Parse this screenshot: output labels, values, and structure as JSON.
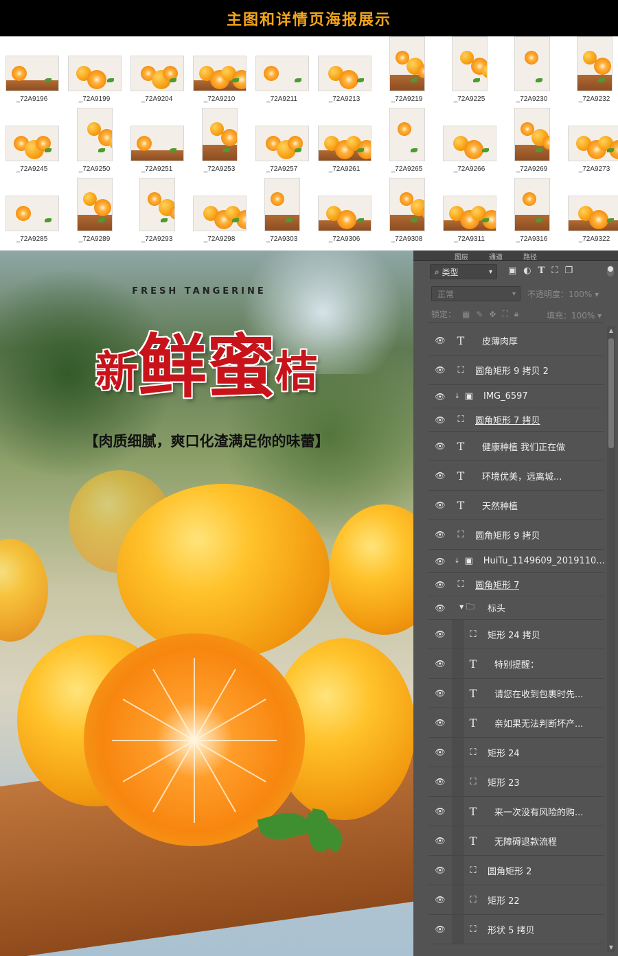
{
  "header": {
    "title": "主图和详情页海报展示"
  },
  "thumbnails": [
    {
      "label": "_72A9196"
    },
    {
      "label": "_72A9199"
    },
    {
      "label": "_72A9204"
    },
    {
      "label": "_72A9210"
    },
    {
      "label": "_72A9211"
    },
    {
      "label": "_72A9213"
    },
    {
      "label": "_72A9219"
    },
    {
      "label": "_72A9225"
    },
    {
      "label": "_72A9230"
    },
    {
      "label": "_72A9232"
    },
    {
      "label": "_72A9245"
    },
    {
      "label": "_72A9250"
    },
    {
      "label": "_72A9251"
    },
    {
      "label": "_72A9253"
    },
    {
      "label": "_72A9257"
    },
    {
      "label": "_72A9261"
    },
    {
      "label": "_72A9265"
    },
    {
      "label": "_72A9266"
    },
    {
      "label": "_72A9269"
    },
    {
      "label": "_72A9273"
    },
    {
      "label": "_72A9285"
    },
    {
      "label": "_72A9289"
    },
    {
      "label": "_72A9293"
    },
    {
      "label": "_72A9298"
    },
    {
      "label": "_72A9303"
    },
    {
      "label": "_72A9306"
    },
    {
      "label": "_72A9308"
    },
    {
      "label": "_72A9311"
    },
    {
      "label": "_72A9316"
    },
    {
      "label": "_72A9322"
    }
  ],
  "poster": {
    "tagline": "FRESH TANGERINE",
    "title_prefix": "新",
    "title_main": "鲜蜜",
    "title_suffix": "桔",
    "subtitle": "【肉质细腻，爽口化渣满足你的味蕾】",
    "title_color": "#c8131a"
  },
  "layers_panel": {
    "tabs": [
      "图层",
      "通道",
      "路径"
    ],
    "filter_label": "类型",
    "blend_mode": "正常",
    "opacity_label": "不透明度：",
    "opacity_value": "100%",
    "lock_label": "锁定：",
    "fill_label": "填充：",
    "fill_value": "100%",
    "layers": [
      {
        "name": "皮薄肉厚",
        "type": "text",
        "indent": 0
      },
      {
        "name": "圆角矩形 9 拷贝 2",
        "type": "shape",
        "indent": 0
      },
      {
        "name": "IMG_6597",
        "type": "image-clipped",
        "indent": 0
      },
      {
        "name": "圆角矩形 7 拷贝",
        "type": "shape",
        "indent": 0,
        "underline": true
      },
      {
        "name": "健康种植 我们正在做",
        "type": "text",
        "indent": 0
      },
      {
        "name": "环境优美，远离城...",
        "type": "text",
        "indent": 0
      },
      {
        "name": "天然种植",
        "type": "text",
        "indent": 0
      },
      {
        "name": "圆角矩形 9 拷贝",
        "type": "shape",
        "indent": 0
      },
      {
        "name": "HuiTu_1149609_2019110...",
        "type": "image-clipped",
        "indent": 0
      },
      {
        "name": "圆角矩形 7",
        "type": "shape",
        "indent": 0,
        "underline": true
      },
      {
        "name": "标头",
        "type": "group",
        "indent": 0
      },
      {
        "name": "矩形 24 拷贝",
        "type": "shape",
        "indent": 1
      },
      {
        "name": "特别提醒：",
        "type": "text",
        "indent": 1
      },
      {
        "name": "请您在收到包裹时先...",
        "type": "text",
        "indent": 1
      },
      {
        "name": "亲如果无法判断坏产...",
        "type": "text",
        "indent": 1
      },
      {
        "name": "矩形 24",
        "type": "shape",
        "indent": 1
      },
      {
        "name": "矩形 23",
        "type": "shape",
        "indent": 1
      },
      {
        "name": "来一次没有风险的购...",
        "type": "text",
        "indent": 1
      },
      {
        "name": "无障碍退款流程",
        "type": "text",
        "indent": 1
      },
      {
        "name": "圆角矩形 2",
        "type": "shape",
        "indent": 1
      },
      {
        "name": "矩形 22",
        "type": "shape",
        "indent": 1
      },
      {
        "name": "形状 5 拷贝",
        "type": "shape",
        "indent": 1
      }
    ]
  },
  "colors": {
    "header_bg": "#000000",
    "header_text": "#f4a51c",
    "panel_bg": "#535353"
  }
}
